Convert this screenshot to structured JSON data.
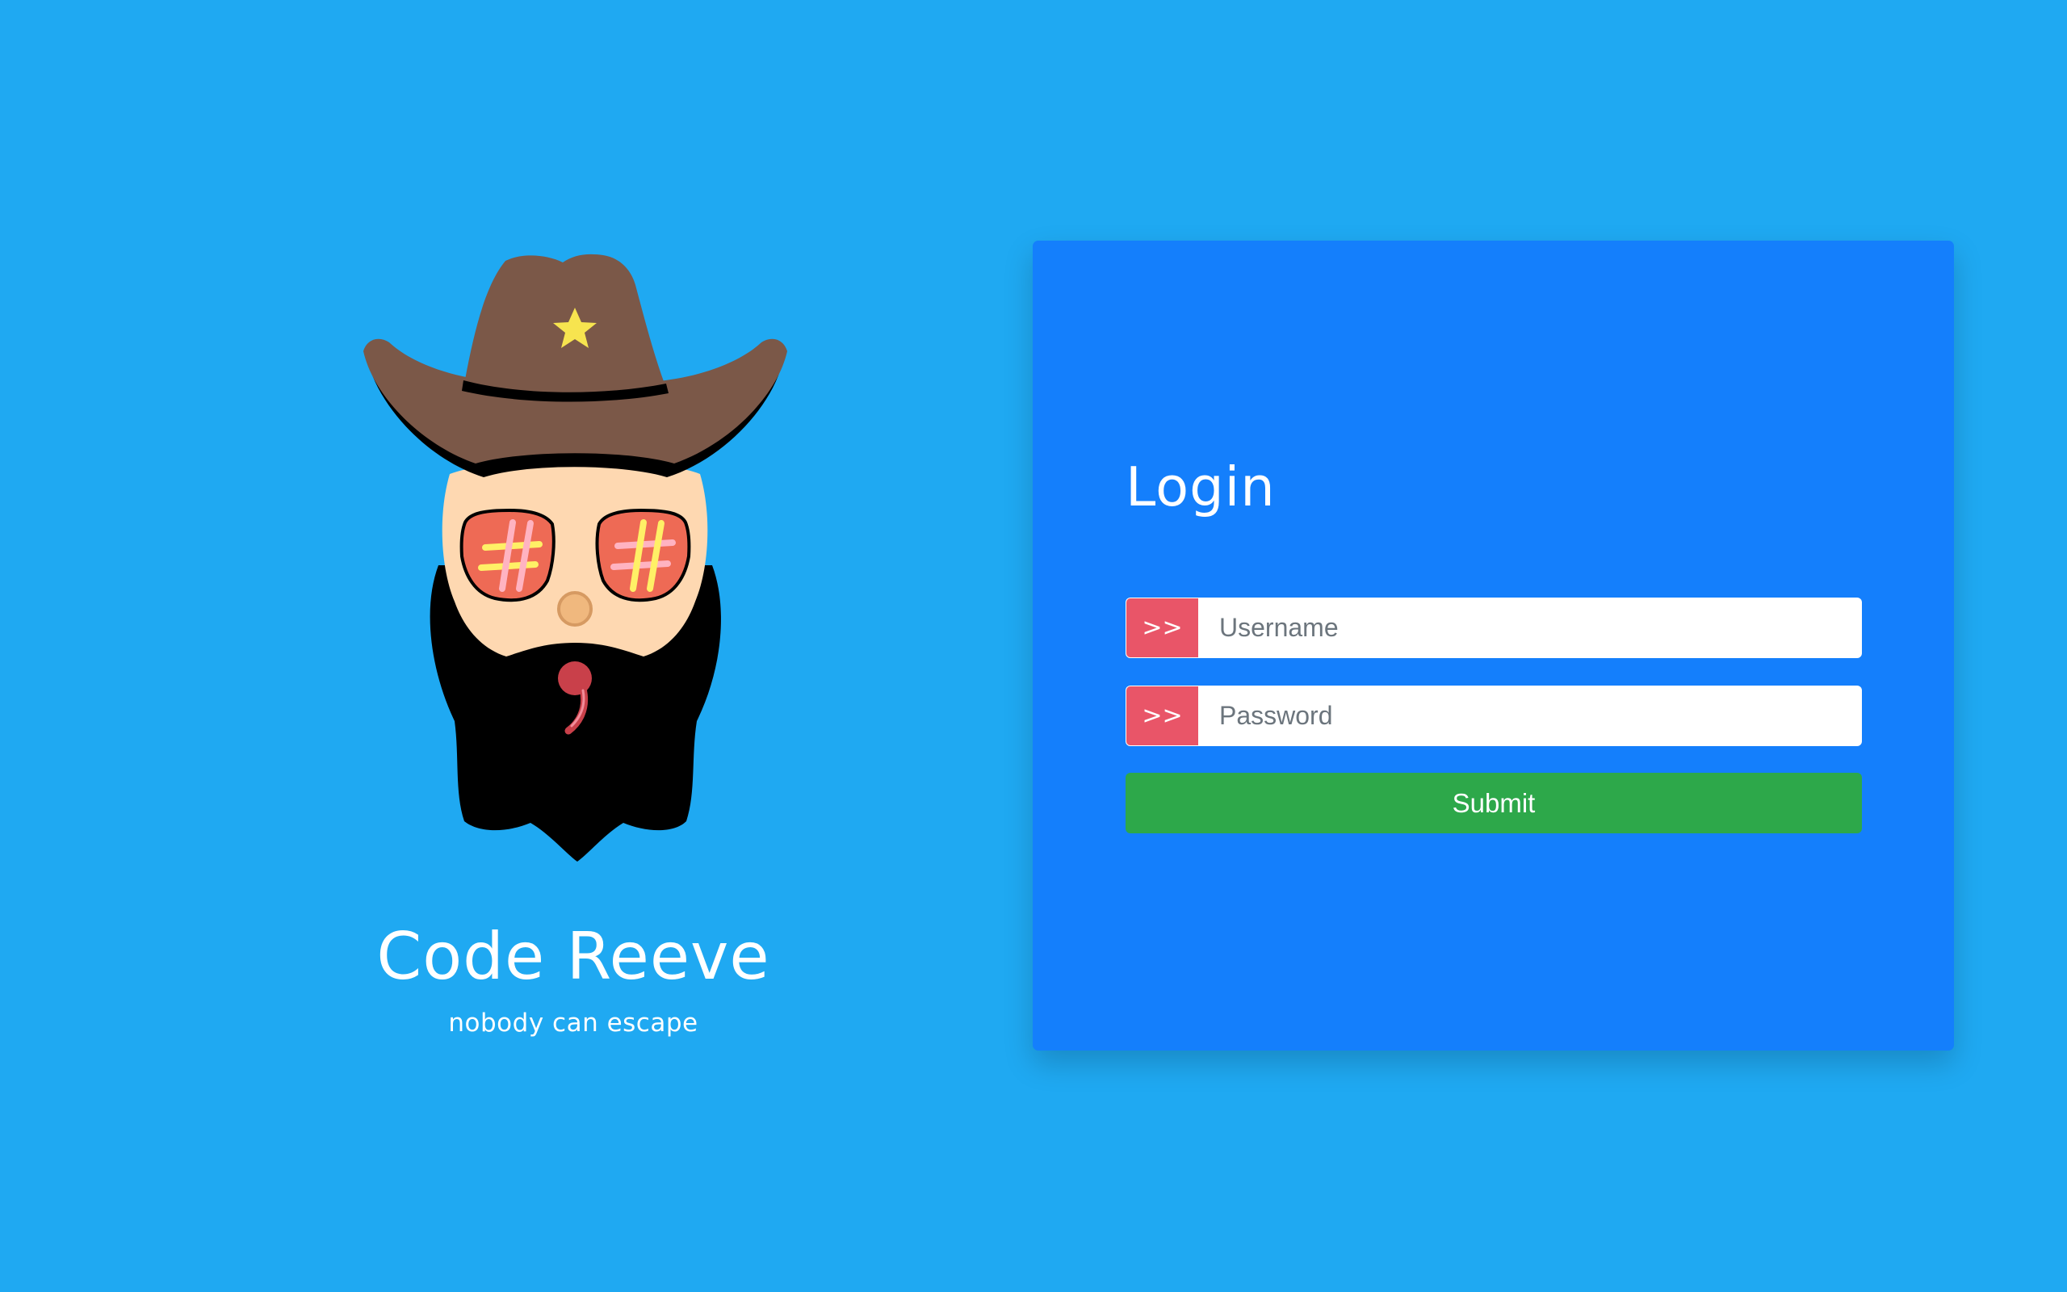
{
  "brand": {
    "title": "Code Reeve",
    "tagline": "nobody can escape",
    "mascot_icon": "sheriff-mascot-icon"
  },
  "login": {
    "title": "Login",
    "username_prefix": ">>",
    "username_placeholder": "Username",
    "password_prefix": ">>",
    "password_placeholder": "Password",
    "submit_label": "Submit"
  },
  "colors": {
    "background": "#1fa9f2",
    "card": "#147ffc",
    "prefix": "#e95568",
    "submit": "#2da84a",
    "hat": "#7b5848",
    "star": "#f7e44f",
    "skin": "#fed8b1",
    "beard": "#000000"
  }
}
